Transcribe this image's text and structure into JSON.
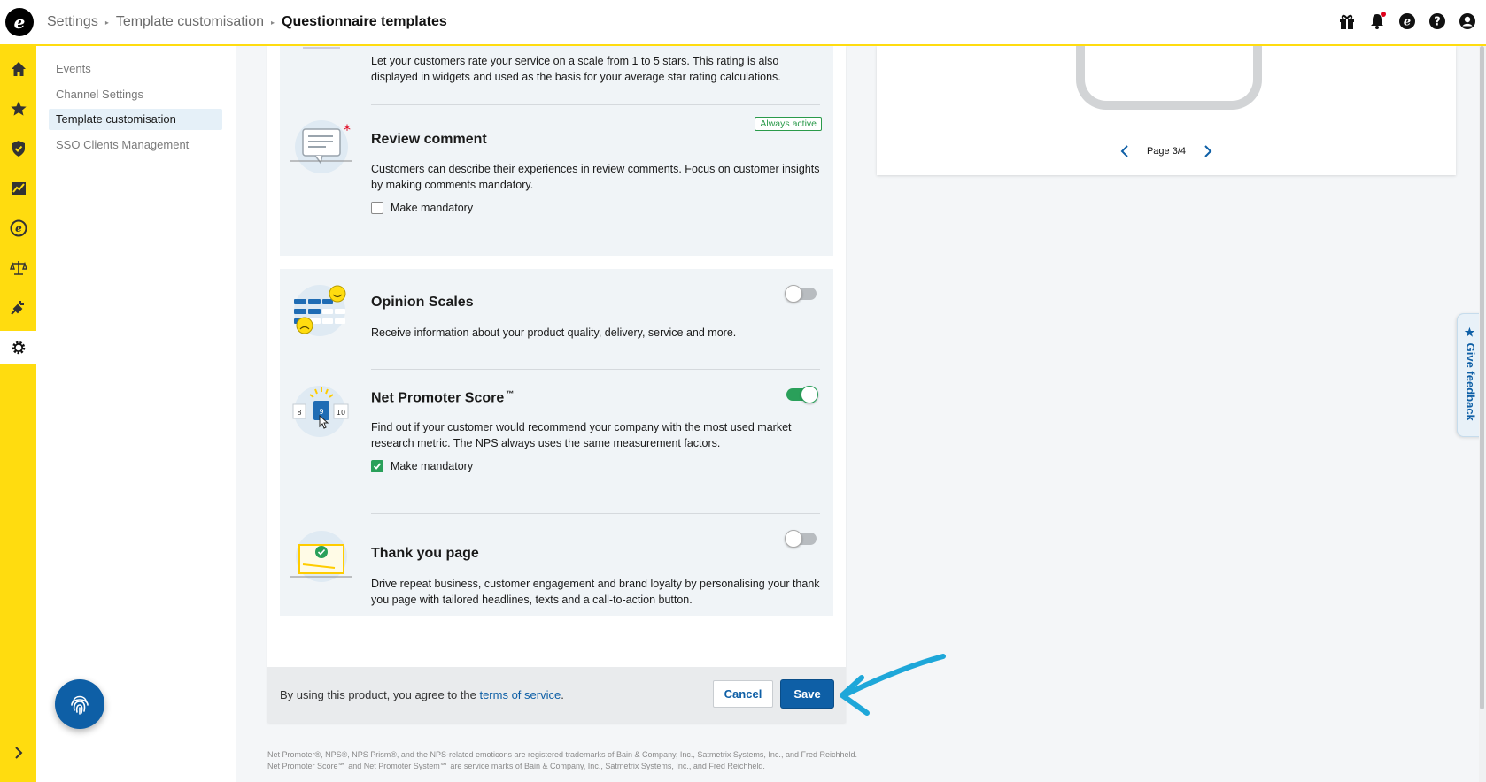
{
  "breadcrumb": {
    "items": [
      "Settings",
      "Template customisation"
    ],
    "current": "Questionnaire templates"
  },
  "subnav": {
    "items": [
      {
        "label": "Events",
        "active": false
      },
      {
        "label": "Channel Settings",
        "active": false
      },
      {
        "label": "Template customisation",
        "active": true
      },
      {
        "label": "SSO Clients Management",
        "active": false
      }
    ]
  },
  "rail": {
    "icons": [
      "home-icon",
      "star-icon",
      "shield-check-icon",
      "chart-line-icon",
      "trusted-e-icon",
      "scales-icon",
      "plug-icon",
      "gear-icon"
    ],
    "active": "gear-icon"
  },
  "features": {
    "star_rating": {
      "desc": "Let your customers rate your service on a scale from 1 to 5 stars. This rating is also displayed in widgets and used as the basis for your average star rating calculations."
    },
    "review_comment": {
      "title": "Review comment",
      "badge": "Always active",
      "desc": "Customers can describe their experiences in review comments. Focus on customer insights by making comments mandatory.",
      "mandatory_label": "Make mandatory",
      "mandatory": false
    },
    "opinion_scales": {
      "title": "Opinion Scales",
      "desc": "Receive information about your product quality, delivery, service and more.",
      "enabled": false
    },
    "nps": {
      "title": "Net Promoter Score",
      "tm": "™",
      "desc": "Find out if your customer would recommend your company with the most used market research metric. The NPS always uses the same measurement factors.",
      "mandatory_label": "Make mandatory",
      "mandatory": true,
      "enabled": true,
      "illus_numbers": [
        "8",
        "9",
        "10"
      ]
    },
    "thank_you": {
      "title": "Thank you page",
      "desc": "Drive repeat business, customer engagement and brand loyalty by personalising your thank you page with tailored headlines, texts and a call-to-action button.",
      "enabled": false
    }
  },
  "footer": {
    "terms_prefix": "By using this product, you agree to the ",
    "terms_link": "terms of service",
    "terms_suffix": ".",
    "cancel": "Cancel",
    "save": "Save"
  },
  "legal": "Net Promoter®, NPS®, NPS Prism®, and the NPS-related emoticons are registered trademarks of Bain & Company, Inc., Satmetrix Systems, Inc., and Fred Reichheld. Net Promoter Score℠ and Net Promoter System℠ are service marks of Bain & Company, Inc., Satmetrix Systems, Inc., and Fred Reichheld.",
  "preview": {
    "page_label": "Page 3/4"
  },
  "feedback": {
    "label": "Give feedback"
  },
  "colors": {
    "brand_yellow": "#ffdc0f",
    "primary_blue": "#0e5fa6",
    "success_green": "#2aa05a",
    "annotation_arrow": "#1ea7d9"
  }
}
